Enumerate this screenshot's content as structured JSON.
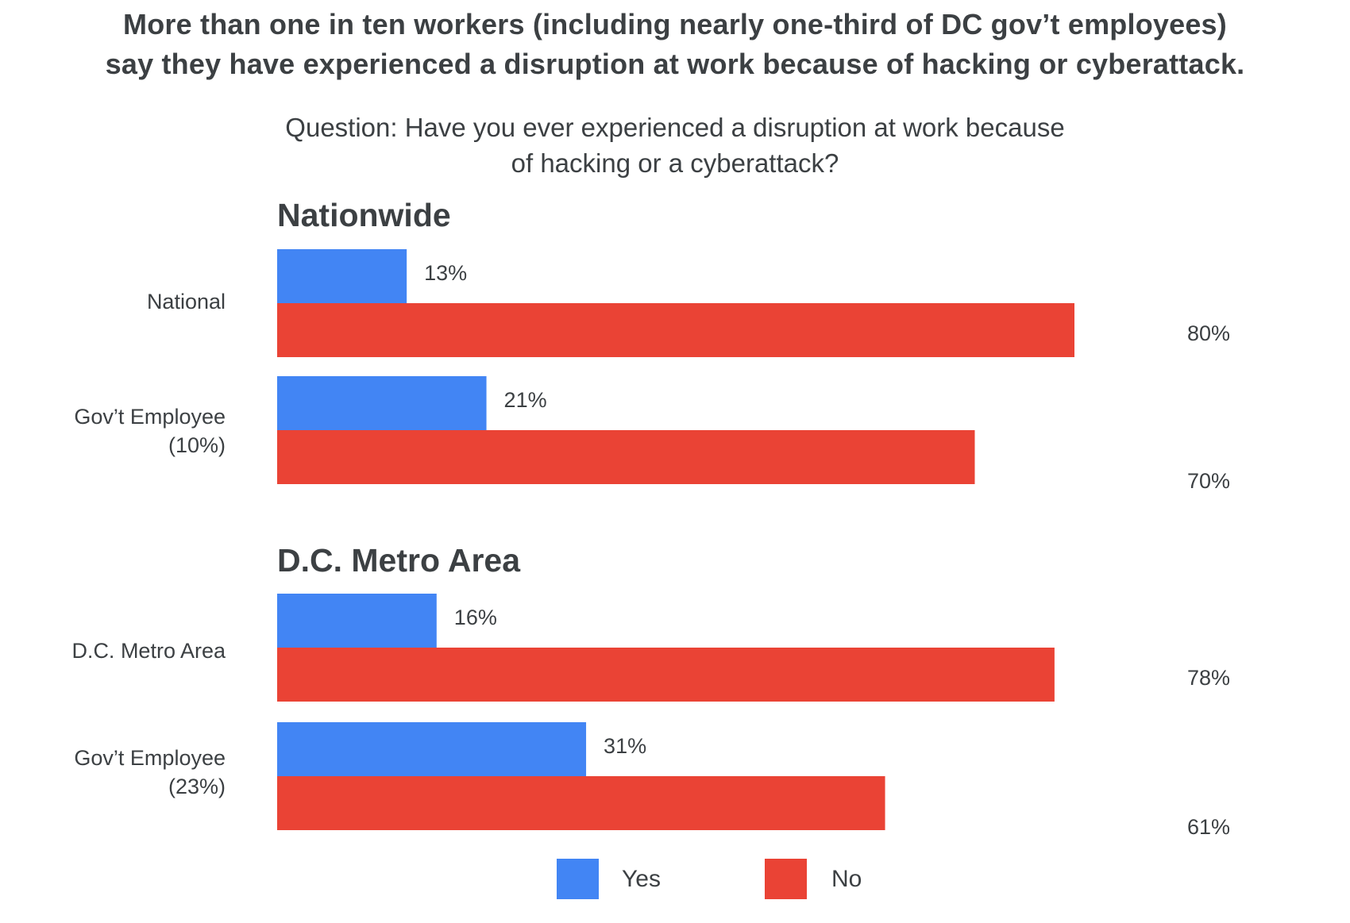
{
  "title": {
    "line1": "More than one in ten workers (including nearly one-third of DC gov’t employees)",
    "line2": "say they have experienced a disruption at work because of hacking or cyberattack."
  },
  "subtitle": {
    "line1": "Question: Have you ever experienced a disruption at work because",
    "line2": "of hacking or a cyberattack?"
  },
  "colors": {
    "yes": "#4285f4",
    "no": "#ea4335",
    "text": "#3c4043"
  },
  "chart_data": {
    "type": "bar",
    "orientation": "horizontal",
    "title": "More than one in ten workers (including nearly one-third of DC gov’t employees) say they have experienced a disruption at work because of hacking or cyberattack.",
    "subtitle": "Question: Have you ever experienced a disruption at work because of hacking or a cyberattack?",
    "xlabel": "",
    "ylabel": "",
    "unit": "%",
    "xlim": [
      0,
      100
    ],
    "grid": false,
    "legend": {
      "placement": "bottom-center",
      "entries": [
        "Yes",
        "No"
      ]
    },
    "series": [
      {
        "name": "Yes",
        "color": "#4285f4"
      },
      {
        "name": "No",
        "color": "#ea4335"
      }
    ],
    "groups": [
      {
        "name": "Nationwide",
        "categories": [
          {
            "label_lines": [
              "National"
            ],
            "yes": 13,
            "no": 80,
            "yes_label": "13%",
            "no_label": "80%"
          },
          {
            "label_lines": [
              "Gov’t Employee",
              "(10%)"
            ],
            "yes": 21,
            "no": 70,
            "yes_label": "21%",
            "no_label": "70%"
          }
        ]
      },
      {
        "name": "D.C. Metro Area",
        "categories": [
          {
            "label_lines": [
              "D.C. Metro Area"
            ],
            "yes": 16,
            "no": 78,
            "yes_label": "16%",
            "no_label": "78%"
          },
          {
            "label_lines": [
              "Gov’t Employee",
              "(23%)"
            ],
            "yes": 31,
            "no": 61,
            "yes_label": "31%",
            "no_label": "61%"
          }
        ]
      }
    ]
  },
  "legend": {
    "yes_label": "Yes",
    "no_label": "No"
  }
}
